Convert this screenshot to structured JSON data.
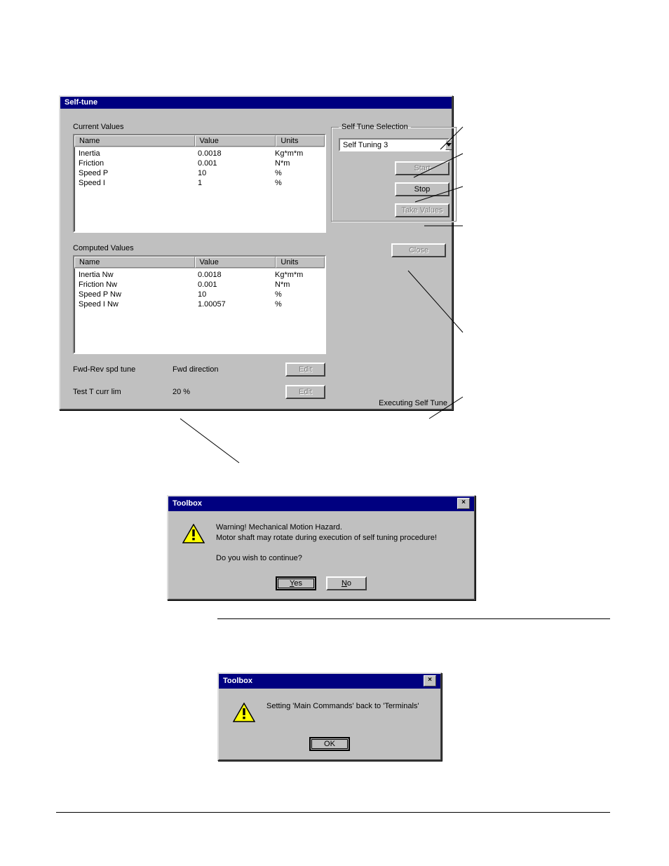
{
  "selftune": {
    "title": "Self-tune",
    "current_label": "Current Values",
    "computed_label": "Computed Values",
    "headers": {
      "name": "Name",
      "value": "Value",
      "units": "Units"
    },
    "current": [
      {
        "name": "Inertia",
        "value": "0.0018",
        "units": "Kg*m*m"
      },
      {
        "name": "Friction",
        "value": "0.001",
        "units": "N*m"
      },
      {
        "name": "Speed P",
        "value": "10",
        "units": "%"
      },
      {
        "name": "Speed I",
        "value": "1",
        "units": "%"
      }
    ],
    "computed": [
      {
        "name": "Inertia Nw",
        "value": "0.0018",
        "units": "Kg*m*m"
      },
      {
        "name": "Friction Nw",
        "value": "0.001",
        "units": "N*m"
      },
      {
        "name": "Speed P Nw",
        "value": "10",
        "units": "%"
      },
      {
        "name": "Speed I Nw",
        "value": "1.00057",
        "units": "%"
      }
    ],
    "params": {
      "fwdrev_label": "Fwd-Rev spd tune",
      "fwdrev_value": "Fwd direction",
      "testT_label": "Test T curr lim",
      "testT_value": "20  %"
    },
    "edit_label": "Edit",
    "group_legend": "Self Tune Selection",
    "dropdown_value": "Self Tuning 3",
    "start_label": "Start",
    "stop_label": "Stop",
    "take_label": "Take Values",
    "close_label": "Close",
    "status": "Executing Self Tune"
  },
  "warn1": {
    "title": "Toolbox",
    "line1": "Warning! Mechanical Motion Hazard.",
    "line2": "Motor shaft may rotate during execution of self tuning procedure!",
    "line3": "Do you wish to continue?",
    "yes": "Yes",
    "no": "No"
  },
  "warn2": {
    "title": "Toolbox",
    "msg": "Setting 'Main Commands' back to 'Terminals'",
    "ok": "OK"
  }
}
